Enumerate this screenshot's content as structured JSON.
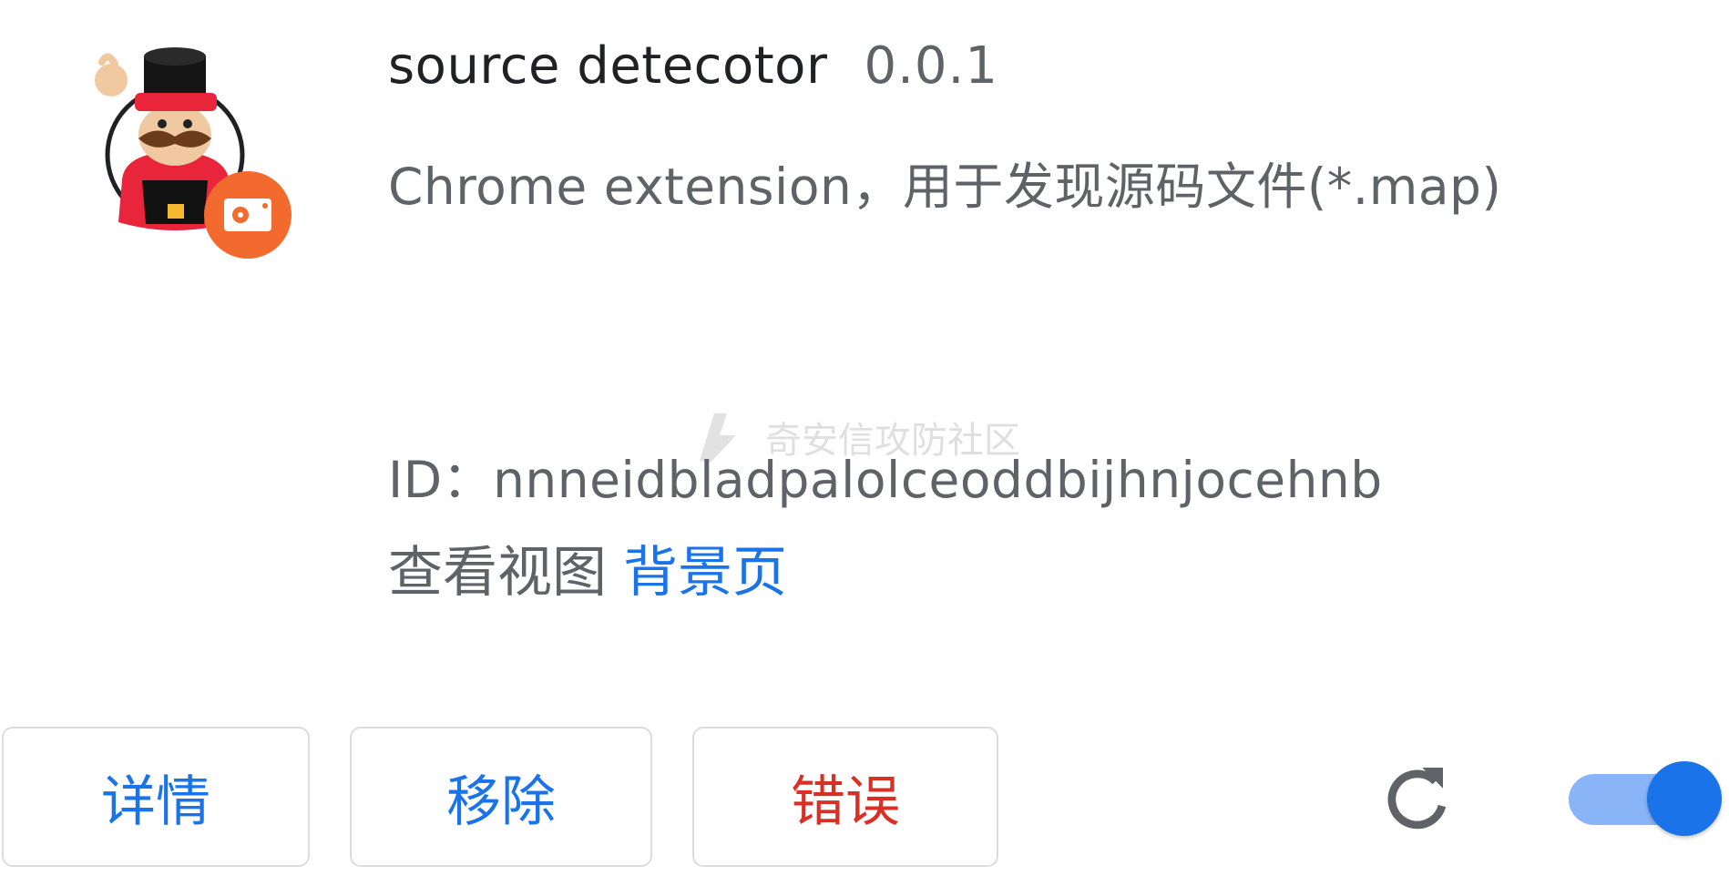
{
  "extension": {
    "name": "source detecotor",
    "version": "0.0.1",
    "description": "Chrome extension，用于发现源码文件(*.map)",
    "id_text": "ID：nnneidbladpalolceoddbijhnjocehnb",
    "views_label": "查看视图",
    "views_link": "背景页",
    "enabled": true
  },
  "watermark": {
    "text": "奇安信攻防社区",
    "icon": "watermark-logo-icon"
  },
  "buttons": {
    "details": "详情",
    "remove": "移除",
    "errors": "错误"
  },
  "icons": {
    "logo": "yeoman-character-icon",
    "badge": "disk-badge-icon",
    "reload": "reload-icon",
    "toggle": "enable-toggle"
  },
  "colors": {
    "link_blue": "#1a73e8",
    "error_red": "#d93025",
    "toggle_track": "#8ab4f8",
    "toggle_knob": "#1a73e8",
    "badge_orange": "#f26a2e"
  }
}
